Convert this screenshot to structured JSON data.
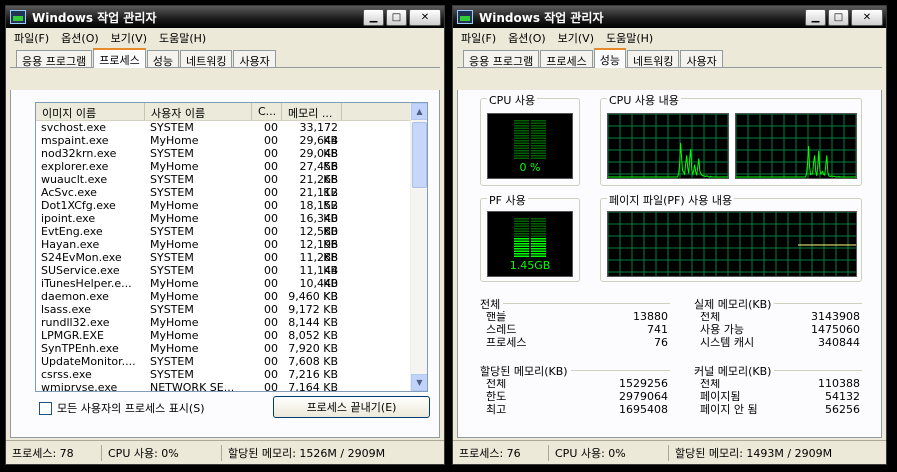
{
  "left": {
    "title": "Windows 작업 관리자",
    "menu": [
      "파일(F)",
      "옵션(O)",
      "보기(V)",
      "도움말(H)"
    ],
    "tabs": [
      "응용 프로그램",
      "프로세스",
      "성능",
      "네트워킹",
      "사용자"
    ],
    "active_tab": 1,
    "columns": [
      "이미지 이름",
      "사용자 이름",
      "C...",
      "메모리 ..."
    ],
    "processes": [
      [
        "svchost.exe",
        "SYSTEM",
        "00",
        "33,172 KB"
      ],
      [
        "mspaint.exe",
        "MyHome",
        "00",
        "29,644 KB"
      ],
      [
        "nod32krn.exe",
        "SYSTEM",
        "00",
        "29,048 KB"
      ],
      [
        "explorer.exe",
        "MyHome",
        "00",
        "27,456 KB"
      ],
      [
        "wuauclt.exe",
        "SYSTEM",
        "00",
        "21,268 KB"
      ],
      [
        "AcSvc.exe",
        "SYSTEM",
        "00",
        "21,112 KB"
      ],
      [
        "Dot1XCfg.exe",
        "MyHome",
        "00",
        "18,152 KB"
      ],
      [
        "ipoint.exe",
        "MyHome",
        "00",
        "16,340 KB"
      ],
      [
        "EvtEng.exe",
        "SYSTEM",
        "00",
        "12,580 KB"
      ],
      [
        "Hayan.exe",
        "MyHome",
        "00",
        "12,196 KB"
      ],
      [
        "S24EvMon.exe",
        "SYSTEM",
        "00",
        "11,288 KB"
      ],
      [
        "SUService.exe",
        "SYSTEM",
        "00",
        "11,144 KB"
      ],
      [
        "iTunesHelper.e...",
        "MyHome",
        "00",
        "10,440 KB"
      ],
      [
        "daemon.exe",
        "MyHome",
        "00",
        "9,460 KB"
      ],
      [
        "lsass.exe",
        "SYSTEM",
        "00",
        "9,172 KB"
      ],
      [
        "rundll32.exe",
        "MyHome",
        "00",
        "8,144 KB"
      ],
      [
        "LPMGR.EXE",
        "MyHome",
        "00",
        "8,052 KB"
      ],
      [
        "SynTPEnh.exe",
        "MyHome",
        "00",
        "7,920 KB"
      ],
      [
        "UpdateMonitor....",
        "SYSTEM",
        "00",
        "7,608 KB"
      ],
      [
        "csrss.exe",
        "SYSTEM",
        "00",
        "7,216 KB"
      ],
      [
        "wmiprvse.exe",
        "NETWORK SE...",
        "00",
        "7,164 KB"
      ]
    ],
    "show_all_label": "모든 사용자의 프로세스 표시(S)",
    "end_process_label": "프로세스 끝내기(E)",
    "status": [
      "프로세스: 78",
      "CPU 사용: 0%",
      "할당된 메모리: 1526M / 2909M"
    ]
  },
  "right": {
    "title": "Windows 작업 관리자",
    "menu": [
      "파일(F)",
      "옵션(O)",
      "보기(V)",
      "도움말(H)"
    ],
    "tabs": [
      "응용 프로그램",
      "프로세스",
      "성능",
      "네트워킹",
      "사용자"
    ],
    "active_tab": 2,
    "cpu_usage_label": "CPU 사용",
    "cpu_usage_value": "0 %",
    "cpu_usage_percent": 0,
    "cpu_history_label": "CPU 사용 내용",
    "pf_usage_label": "PF 사용",
    "pf_usage_value": "1.45GB",
    "pf_usage_fraction": 0.5,
    "pf_history_label": "페이지 파일(PF) 사용 내용",
    "totals": {
      "title": "전체",
      "rows": [
        [
          "핸들",
          "13880"
        ],
        [
          "스레드",
          "741"
        ],
        [
          "프로세스",
          "76"
        ]
      ]
    },
    "physical": {
      "title": "실제 메모리(KB)",
      "rows": [
        [
          "전체",
          "3143908"
        ],
        [
          "사용 가능",
          "1475060"
        ],
        [
          "시스템 캐시",
          "340844"
        ]
      ]
    },
    "commit": {
      "title": "할당된 메모리(KB)",
      "rows": [
        [
          "전체",
          "1529256"
        ],
        [
          "한도",
          "2979064"
        ],
        [
          "최고",
          "1695408"
        ]
      ]
    },
    "kernel": {
      "title": "커널 메모리(KB)",
      "rows": [
        [
          "전체",
          "110388"
        ],
        [
          "페이지됨",
          "54132"
        ],
        [
          "페이지 안 됨",
          "56256"
        ]
      ]
    },
    "status": [
      "프로세스: 76",
      "CPU 사용: 0%",
      "할당된 메모리: 1493M / 2909M"
    ]
  },
  "colors": {
    "graph_grid": "#008040",
    "graph_line": "#00ff00",
    "pf_line": "#ffff80"
  },
  "icons": [
    "minimize-icon",
    "maximize-icon",
    "close-icon",
    "taskmgr-icon"
  ]
}
